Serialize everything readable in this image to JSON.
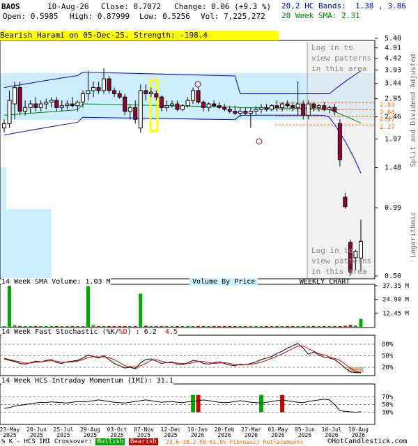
{
  "header": {
    "ticker": "BAOS",
    "date": "10-Aug-26",
    "close": "Close: 0.7072",
    "change": "Change: 0.06 (+9.3 %)",
    "open": "Open: 0.5985",
    "high": "High: 0.87999",
    "low": "Low: 0.5256",
    "vol": "Vol: 7,225,272",
    "bands_label": "20,2 HC Bands:",
    "bands_values": "1.38 , 3.86",
    "sma_label": "20 Week SMA: 2.31"
  },
  "banner": "Bearish Harami on 05-Dec-25. Strength: -198.4",
  "login_top": [
    "Log in to",
    "view patterns",
    "in this area"
  ],
  "login_bottom": [
    "Log in to",
    "view patterns",
    "in this area"
  ],
  "price_axis_label": "Split and Dividend Adjusted",
  "log_label": "Logarithmic",
  "fib_labels": [
    "2.83",
    "2.64",
    "2.47",
    "2.27"
  ],
  "volume_panel": {
    "title": "14 Week SMA Volume: 1.03 M",
    "vbp": "Volume By Price",
    "weekly": "WEEKLY CHART",
    "ticks": [
      "37.35 M",
      "24.90 M",
      "12.45 M"
    ]
  },
  "stoch_panel": {
    "title_prefix": "14 Week Fast Stochastic (",
    "title_k": "%K",
    "title_d": "%D",
    "title_suffix": ") : 6.2",
    "title_value2": "4.5",
    "ticks": [
      "80%",
      "50%",
      "20%"
    ]
  },
  "momentum_panel": {
    "title": "14 Week HCS Intraday Momentum (IMI): 31.1",
    "ticks": [
      "70%",
      "50%",
      "30%"
    ]
  },
  "footer": {
    "legend_prefix": "% K - HCS IMI Crossover:",
    "bullish": "Bullish",
    "bearish": "Bearish",
    "fib": "23.6-38.2-50-61.8% Fibonacci Retracements",
    "copyright": "©HotCandlestick.com"
  },
  "colors": {
    "bullish": "#00aa00",
    "bearish": "#cc0000",
    "band": "#0000cc",
    "sma": "#008000",
    "bbfill": "#cceeff"
  },
  "chart_data": [
    {
      "type": "candlestick",
      "title": "BAOS",
      "ylabel": "Split and Dividend Adjusted",
      "y_scale": "log",
      "y_ticks": [
        "5.40",
        "4.91",
        "4.42",
        "3.93",
        "3.44",
        "2.95",
        "2.46",
        "1.97",
        "1.48",
        "0.99",
        "0.50"
      ],
      "x_ticks": [
        "23-May 2025",
        "20-Jun 2025",
        "25-Jul 2025",
        "29-Aug 2025",
        "03-Oct 2025",
        "07-Nov 2025",
        "12-Dec 2025",
        "16-Jan 2026",
        "20-Feb 2026",
        "27-Mar 2026",
        "01-May 2026",
        "05-Jun 2026",
        "10-Jul 2026",
        "10-Aug 2026"
      ],
      "candles": [
        {
          "o": 2.2,
          "h": 2.4,
          "l": 2.1,
          "c": 2.3
        },
        {
          "o": 2.3,
          "h": 3.2,
          "l": 2.2,
          "c": 2.9
        },
        {
          "o": 2.8,
          "h": 3.5,
          "l": 2.4,
          "c": 3.3
        },
        {
          "o": 3.3,
          "h": 3.5,
          "l": 2.5,
          "c": 2.6
        },
        {
          "o": 2.6,
          "h": 2.9,
          "l": 2.5,
          "c": 2.7
        },
        {
          "o": 2.7,
          "h": 2.9,
          "l": 2.55,
          "c": 2.8
        },
        {
          "o": 2.8,
          "h": 3.0,
          "l": 2.6,
          "c": 2.7
        },
        {
          "o": 2.7,
          "h": 2.9,
          "l": 2.6,
          "c": 2.8
        },
        {
          "o": 2.8,
          "h": 2.95,
          "l": 2.65,
          "c": 2.85
        },
        {
          "o": 2.85,
          "h": 3.0,
          "l": 2.7,
          "c": 2.9
        },
        {
          "o": 2.9,
          "h": 3.0,
          "l": 2.6,
          "c": 2.7
        },
        {
          "o": 2.7,
          "h": 2.9,
          "l": 2.6,
          "c": 2.75
        },
        {
          "o": 2.75,
          "h": 2.9,
          "l": 2.65,
          "c": 2.8
        },
        {
          "o": 2.8,
          "h": 3.0,
          "l": 2.7,
          "c": 2.75
        },
        {
          "o": 2.75,
          "h": 2.9,
          "l": 2.6,
          "c": 2.85
        },
        {
          "o": 2.85,
          "h": 3.2,
          "l": 2.7,
          "c": 3.1
        },
        {
          "o": 3.1,
          "h": 3.9,
          "l": 2.9,
          "c": 3.2
        },
        {
          "o": 3.2,
          "h": 3.5,
          "l": 3.0,
          "c": 3.3
        },
        {
          "o": 3.3,
          "h": 3.5,
          "l": 3.1,
          "c": 3.2
        },
        {
          "o": 3.2,
          "h": 4.0,
          "l": 3.1,
          "c": 3.6
        },
        {
          "o": 3.6,
          "h": 3.7,
          "l": 3.1,
          "c": 3.2
        },
        {
          "o": 3.2,
          "h": 3.3,
          "l": 3.0,
          "c": 3.1
        },
        {
          "o": 3.1,
          "h": 3.2,
          "l": 2.95,
          "c": 3.0
        },
        {
          "o": 3.0,
          "h": 3.1,
          "l": 2.5,
          "c": 2.6
        },
        {
          "o": 2.6,
          "h": 2.8,
          "l": 2.4,
          "c": 2.7
        },
        {
          "o": 2.7,
          "h": 2.9,
          "l": 2.3,
          "c": 2.4
        },
        {
          "o": 2.2,
          "h": 3.4,
          "l": 2.1,
          "c": 3.2
        },
        {
          "o": 3.2,
          "h": 3.4,
          "l": 2.9,
          "c": 3.1
        },
        {
          "o": 3.1,
          "h": 3.3,
          "l": 3.0,
          "c": 3.15
        },
        {
          "o": 3.1,
          "h": 3.2,
          "l": 2.9,
          "c": 3.0
        },
        {
          "o": 3.0,
          "h": 3.05,
          "l": 2.6,
          "c": 2.7
        },
        {
          "o": 2.7,
          "h": 2.9,
          "l": 2.6,
          "c": 2.75
        },
        {
          "o": 2.75,
          "h": 2.9,
          "l": 2.7,
          "c": 2.8
        },
        {
          "o": 2.8,
          "h": 2.9,
          "l": 2.6,
          "c": 2.65
        },
        {
          "o": 2.65,
          "h": 2.8,
          "l": 2.6,
          "c": 2.75
        },
        {
          "o": 2.75,
          "h": 3.0,
          "l": 2.7,
          "c": 2.9
        },
        {
          "o": 2.9,
          "h": 3.3,
          "l": 2.8,
          "c": 3.2
        },
        {
          "o": 3.2,
          "h": 3.3,
          "l": 2.8,
          "c": 2.85
        },
        {
          "o": 2.85,
          "h": 2.9,
          "l": 2.6,
          "c": 2.7
        },
        {
          "o": 2.7,
          "h": 2.85,
          "l": 2.6,
          "c": 2.8
        },
        {
          "o": 2.8,
          "h": 2.9,
          "l": 2.7,
          "c": 2.75
        },
        {
          "o": 2.75,
          "h": 2.85,
          "l": 2.65,
          "c": 2.7
        },
        {
          "o": 2.7,
          "h": 2.8,
          "l": 2.6,
          "c": 2.65
        },
        {
          "o": 2.65,
          "h": 2.75,
          "l": 2.55,
          "c": 2.6
        },
        {
          "o": 2.6,
          "h": 2.75,
          "l": 2.5,
          "c": 2.55
        },
        {
          "o": 2.55,
          "h": 2.7,
          "l": 2.45,
          "c": 2.6
        },
        {
          "o": 2.6,
          "h": 2.7,
          "l": 2.5,
          "c": 2.55
        },
        {
          "o": 2.55,
          "h": 2.7,
          "l": 2.2,
          "c": 2.6
        },
        {
          "o": 2.6,
          "h": 2.75,
          "l": 2.5,
          "c": 2.65
        },
        {
          "o": 2.65,
          "h": 2.8,
          "l": 2.55,
          "c": 2.7
        },
        {
          "o": 2.7,
          "h": 2.8,
          "l": 2.6,
          "c": 2.65
        },
        {
          "o": 2.65,
          "h": 2.8,
          "l": 2.6,
          "c": 2.75
        },
        {
          "o": 2.75,
          "h": 2.9,
          "l": 2.6,
          "c": 2.7
        },
        {
          "o": 2.7,
          "h": 2.85,
          "l": 2.6,
          "c": 2.8
        },
        {
          "o": 2.8,
          "h": 2.9,
          "l": 2.7,
          "c": 2.75
        },
        {
          "o": 2.75,
          "h": 2.85,
          "l": 2.6,
          "c": 2.7
        },
        {
          "o": 2.7,
          "h": 3.5,
          "l": 2.5,
          "c": 2.8
        },
        {
          "o": 2.8,
          "h": 2.9,
          "l": 2.4,
          "c": 2.5
        },
        {
          "o": 2.5,
          "h": 2.9,
          "l": 2.4,
          "c": 2.8
        },
        {
          "o": 2.8,
          "h": 2.85,
          "l": 2.6,
          "c": 2.7
        },
        {
          "o": 2.7,
          "h": 2.8,
          "l": 2.6,
          "c": 2.75
        },
        {
          "o": 2.75,
          "h": 2.85,
          "l": 2.6,
          "c": 2.65
        },
        {
          "o": 2.65,
          "h": 2.75,
          "l": 2.55,
          "c": 2.7
        },
        {
          "o": 2.7,
          "h": 2.8,
          "l": 2.5,
          "c": 2.6
        },
        {
          "o": 2.3,
          "h": 2.4,
          "l": 1.5,
          "c": 1.6
        },
        {
          "o": 1.1,
          "h": 1.15,
          "l": 0.98,
          "c": 1.0
        },
        {
          "o": 0.7,
          "h": 0.72,
          "l": 0.5,
          "c": 0.52
        },
        {
          "o": 0.6,
          "h": 0.65,
          "l": 0.53,
          "c": 0.64
        },
        {
          "o": 0.5985,
          "h": 0.87999,
          "l": 0.5256,
          "c": 0.7072
        }
      ],
      "hc_bands": {
        "upper": 3.86,
        "lower": 1.38
      },
      "sma20": 2.31,
      "fibonacci": [
        2.83,
        2.64,
        2.47,
        2.27
      ]
    },
    {
      "type": "bar",
      "title": "14 Week SMA Volume: 1.03 M",
      "y_ticks": [
        "37.35 M",
        "24.90 M",
        "12.45 M"
      ],
      "volume_m": [
        0.3,
        37.3,
        1.5,
        0.5,
        0.4,
        0.3,
        0.3,
        0.2,
        0.2,
        0.3,
        0.2,
        0.2,
        0.2,
        0.2,
        0.3,
        0.5,
        37.0,
        1.5,
        0.5,
        0.4,
        0.4,
        0.3,
        0.3,
        0.4,
        0.3,
        0.3,
        30.1,
        1.0,
        0.5,
        0.4,
        0.3,
        0.3,
        0.3,
        0.3,
        0.3,
        0.3,
        0.5,
        0.4,
        0.3,
        0.3,
        0.3,
        0.3,
        0.3,
        0.3,
        0.3,
        0.3,
        0.3,
        0.3,
        0.3,
        0.3,
        0.3,
        0.3,
        0.3,
        0.3,
        0.3,
        0.3,
        0.4,
        0.3,
        0.3,
        0.3,
        0.3,
        0.3,
        0.3,
        0.3,
        0.5,
        1.0,
        1.6,
        1.2,
        7.2
      ]
    },
    {
      "type": "line",
      "title": "14 Week Fast Stochastic (%K/%D) : 6.2 4.5",
      "y_ticks": [
        "80%",
        "50%",
        "20%"
      ],
      "k": [
        42,
        38,
        35,
        30,
        28,
        32,
        36,
        34,
        38,
        40,
        32,
        30,
        34,
        36,
        38,
        44,
        52,
        48,
        44,
        50,
        40,
        30,
        24,
        18,
        20,
        16,
        32,
        40,
        42,
        36,
        30,
        32,
        34,
        28,
        26,
        32,
        38,
        36,
        30,
        28,
        32,
        34,
        30,
        26,
        24,
        28,
        26,
        30,
        34,
        40,
        44,
        48,
        56,
        62,
        70,
        76,
        82,
        70,
        54,
        60,
        52,
        46,
        44,
        40,
        30,
        18,
        8,
        6,
        6.2
      ],
      "d": [
        44,
        40,
        37,
        34,
        31,
        31,
        33,
        34,
        36,
        37,
        36,
        33,
        33,
        34,
        36,
        40,
        45,
        48,
        47,
        47,
        45,
        40,
        32,
        24,
        22,
        20,
        24,
        30,
        38,
        40,
        36,
        32,
        32,
        31,
        30,
        29,
        32,
        35,
        35,
        32,
        30,
        31,
        32,
        30,
        27,
        26,
        26,
        28,
        30,
        33,
        38,
        43,
        49,
        55,
        62,
        69,
        75,
        76,
        68,
        62,
        55,
        52,
        47,
        43,
        38,
        28,
        18,
        10,
        4.5
      ]
    },
    {
      "type": "line",
      "title": "14 Week HCS Intraday Momentum (IMI): 31.1",
      "y_ticks": [
        "70%",
        "50%",
        "30%"
      ],
      "imi": [
        40,
        42,
        46,
        48,
        50,
        52,
        54,
        56,
        55,
        57,
        56,
        55,
        54,
        56,
        58,
        57,
        58,
        60,
        62,
        60,
        58,
        56,
        55,
        54,
        56,
        58,
        60,
        62,
        60,
        58,
        56,
        57,
        58,
        56,
        55,
        57,
        58,
        60,
        62,
        60,
        58,
        56,
        55,
        56,
        58,
        60,
        58,
        56,
        55,
        54,
        56,
        58,
        60,
        62,
        60,
        58,
        56,
        55,
        58,
        60,
        62,
        64,
        62,
        50,
        34,
        32,
        31,
        30,
        31.1
      ]
    }
  ]
}
